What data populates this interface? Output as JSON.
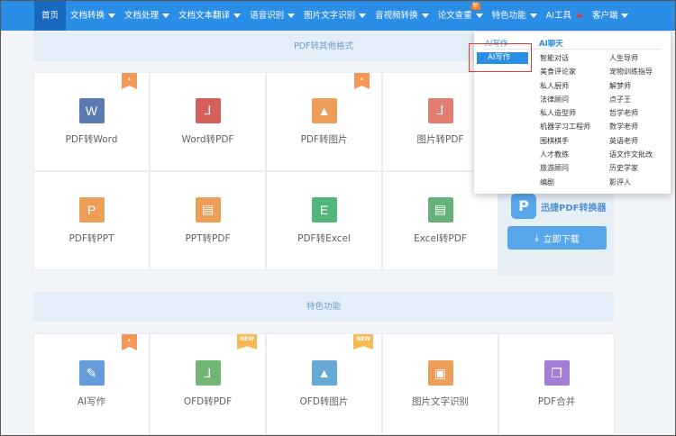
{
  "nav": {
    "items": [
      {
        "label": "首页",
        "active": true
      },
      {
        "label": "文档转换",
        "caret": true
      },
      {
        "label": "文档处理",
        "caret": true
      },
      {
        "label": "文档文本翻译",
        "caret": true
      },
      {
        "label": "语音识别",
        "caret": true
      },
      {
        "label": "图片文字识别",
        "caret": true
      },
      {
        "label": "音视频转换",
        "caret": true
      },
      {
        "label": "论文查重",
        "caret": true,
        "tag": "新"
      },
      {
        "label": "特色功能",
        "caret": true
      },
      {
        "label": "AI工具",
        "caret_up": true
      },
      {
        "label": "客户端",
        "caret": true
      }
    ]
  },
  "sections": {
    "pdf_other": "PDF转其他格式",
    "special": "特色功能"
  },
  "row1": [
    {
      "label": "PDF转Word",
      "icon": "word-icon",
      "glyph": "W",
      "color": "#2b579a",
      "badge": "fire"
    },
    {
      "label": "Word转PDF",
      "icon": "pdf-icon",
      "glyph": "⅃",
      "color": "#c9342b",
      "badge": ""
    },
    {
      "label": "PDF转图片",
      "icon": "image-icon",
      "glyph": "▲",
      "color": "#e8832a",
      "badge": "fire"
    },
    {
      "label": "图片转PDF",
      "icon": "pdf-doc-icon",
      "glyph": "⅃",
      "color": "#d85a4a",
      "badge": ""
    }
  ],
  "row2": [
    {
      "label": "PDF转PPT",
      "icon": "ppt-icon",
      "glyph": "P",
      "color": "#e8832a"
    },
    {
      "label": "PPT转PDF",
      "icon": "ppt-pdf-icon",
      "glyph": "▤",
      "color": "#e8832a"
    },
    {
      "label": "PDF转Excel",
      "icon": "excel-icon",
      "glyph": "E",
      "color": "#22a156"
    },
    {
      "label": "Excel转PDF",
      "icon": "excel-pdf-icon",
      "glyph": "▤",
      "color": "#3a9d52"
    }
  ],
  "promo": {
    "logo": "P",
    "title": "迅捷PDF转换器",
    "button": "立即下载"
  },
  "row3": [
    {
      "label": "AI写作",
      "icon": "pen-icon",
      "glyph": "✎",
      "color": "#3a7fd0",
      "badge": "fire"
    },
    {
      "label": "OFD转PDF",
      "icon": "ofd-pdf-icon",
      "glyph": "⅃",
      "color": "#4aa34c",
      "badge": "NEW"
    },
    {
      "label": "OFD转图片",
      "icon": "ofd-image-icon",
      "glyph": "▲",
      "color": "#3a91c8",
      "badge": "NEW"
    },
    {
      "label": "图片文字识别",
      "icon": "ocr-icon",
      "glyph": "▣",
      "color": "#e8832a",
      "badge": ""
    },
    {
      "label": "PDF合并",
      "icon": "merge-icon",
      "glyph": "❐",
      "color": "#8a5ac9",
      "badge": ""
    }
  ],
  "dropdown": {
    "left_head": "AI写作",
    "right_head": "AI聊天",
    "active": "AI写作",
    "col1": [
      "智能对话",
      "美食评论家",
      "私人厨师",
      "法律顾问",
      "私人造型师",
      "机器学习工程师",
      "围棋棋手",
      "人才教练",
      "旅游顾问",
      "编剧"
    ],
    "col2": [
      "人生导师",
      "宠物训练指导",
      "解梦师",
      "点子王",
      "哲学老师",
      "数学老师",
      "英语老师",
      "语文作文批改",
      "历史学家",
      "影评人"
    ]
  }
}
